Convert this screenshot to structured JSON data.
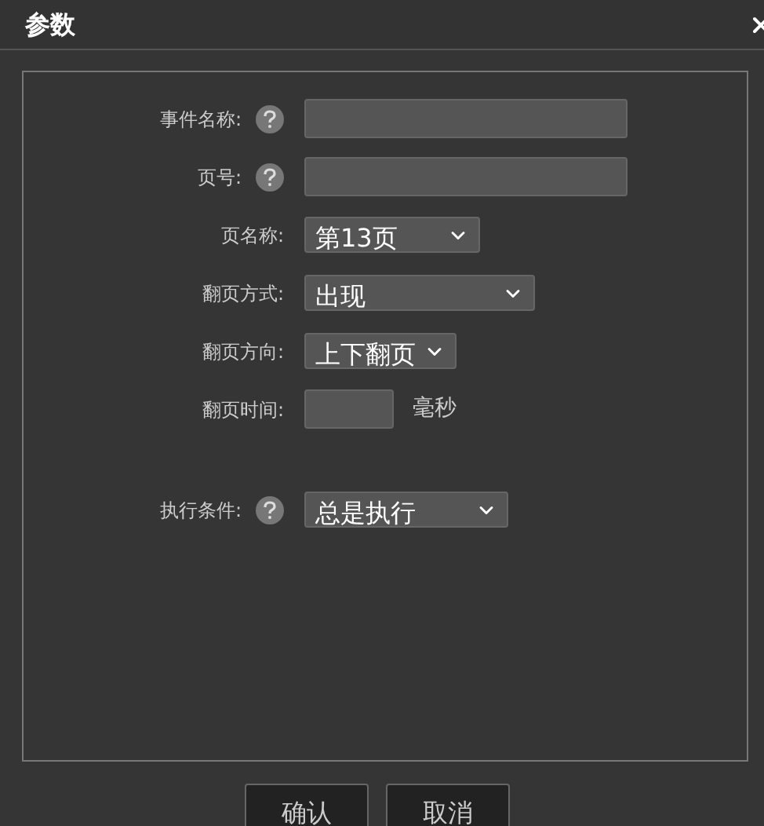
{
  "window": {
    "title": "参数"
  },
  "fields": [
    {
      "kind": "text",
      "label": "事件名称:",
      "help": true
    },
    {
      "kind": "text",
      "label": "页号:",
      "help": true
    },
    {
      "kind": "select",
      "label": "页名称:",
      "help": false,
      "value": "第13页"
    },
    {
      "kind": "select",
      "label": "翻页方式:",
      "help": false,
      "value": "出现"
    },
    {
      "kind": "select",
      "label": "翻页方向:",
      "help": false,
      "value": "上下翻页"
    },
    {
      "kind": "number",
      "label": "翻页时间:",
      "help": false,
      "unit": "毫秒"
    }
  ],
  "condition": {
    "kind": "select",
    "label": "执行条件:",
    "help": true,
    "value": "总是执行"
  },
  "buttons": [
    "确认",
    "取消"
  ]
}
